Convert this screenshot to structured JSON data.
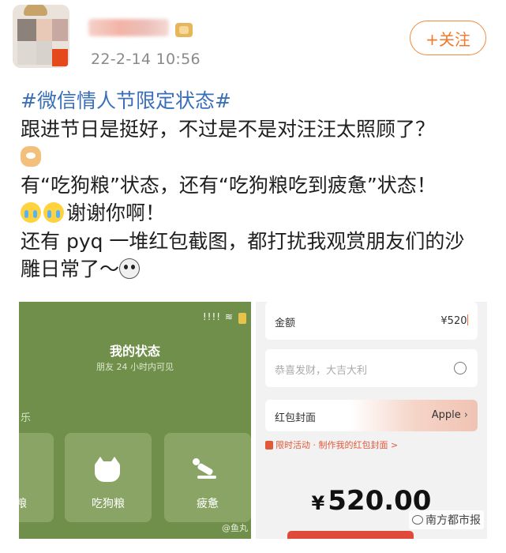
{
  "header": {
    "timestamp": "22-2-14 10:56",
    "follow_label": "+关注"
  },
  "post": {
    "topic": "#微信情人节限定状态#",
    "lines": [
      "跟进节日是挺好，不过是不是对汪汪太照顾了？",
      "有“吃狗粮”状态，还有“吃狗粮吃到疲惫”状态！",
      "谢谢你啊！",
      "还有 pyq 一堆红包截图，都打扰我观赏朋友们的沙",
      "雕日常了～"
    ]
  },
  "left_screenshot": {
    "status_icons": "!!!! ≋",
    "title": "我的状态",
    "subtitle": "朋友 24 小时内可见",
    "cut_text": "乐",
    "cards": [
      {
        "label": "粮"
      },
      {
        "label": "吃狗粮"
      },
      {
        "label": "疲惫"
      }
    ],
    "weibo_mark": "@鱼丸"
  },
  "right_screenshot": {
    "amount_label": "金额",
    "amount_value": "¥520",
    "greeting_placeholder": "恭喜发财，大吉大利",
    "cover_label": "红包封面",
    "cover_value": "Apple",
    "promo_text": "限时活动 · 制作我的红包封面 >",
    "big_amount": "520.00",
    "yen_symbol": "¥",
    "watermark": "南方都市报"
  },
  "colors": {
    "topic_blue": "#3a6fb8",
    "follow_orange": "#f07a2a",
    "status_green": "#6f8f4a",
    "red_accent": "#e05a3a"
  }
}
